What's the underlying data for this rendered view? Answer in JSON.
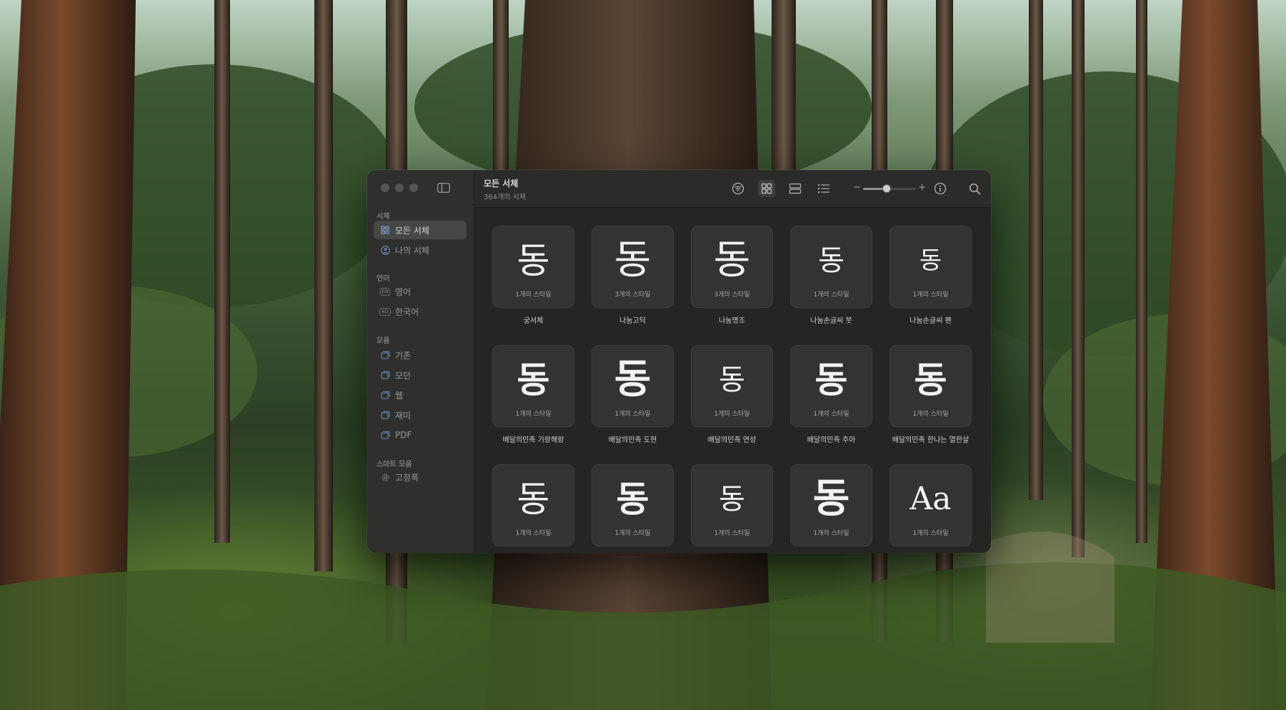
{
  "window": {
    "title": "모든 서체",
    "subtitle": "364개의 서체"
  },
  "sidebar": {
    "sections": {
      "fonts": "서체",
      "language": "언어",
      "collections": "모음",
      "smart": "스마트 모음"
    },
    "items": [
      {
        "label": "모든 서체",
        "icon": "grid-icon",
        "active": true
      },
      {
        "label": "나의 서체",
        "icon": "person-icon"
      },
      {
        "label": "영어",
        "icon": "language-badge-icon",
        "badge": "EN"
      },
      {
        "label": "한국어",
        "icon": "language-badge-icon",
        "badge": "KO"
      },
      {
        "label": "기존",
        "icon": "collection-icon"
      },
      {
        "label": "모던",
        "icon": "collection-icon"
      },
      {
        "label": "웹",
        "icon": "collection-icon"
      },
      {
        "label": "재미",
        "icon": "collection-icon"
      },
      {
        "label": "PDF",
        "icon": "collection-icon"
      },
      {
        "label": "고정폭",
        "icon": "gear-icon"
      }
    ]
  },
  "toolbar": {
    "buttons": [
      "filter-icon",
      "grid-view-icon",
      "strip-view-icon",
      "list-view-icon",
      "info-icon",
      "search-icon"
    ],
    "zoom_minus": "−",
    "zoom_plus": "+",
    "zoom_level": 0.45
  },
  "fonts": [
    {
      "glyph": "동",
      "styles": "1개의 스타일",
      "name": "궁서체"
    },
    {
      "glyph": "동",
      "styles": "3개의 스타일",
      "name": "나눔고딕"
    },
    {
      "glyph": "동",
      "styles": "3개의 스타일",
      "name": "나눔명조"
    },
    {
      "glyph": "동",
      "styles": "1개의 스타일",
      "name": "나눔손글씨 붓"
    },
    {
      "glyph": "동",
      "styles": "1개의 스타일",
      "name": "나눔손글씨 펜"
    },
    {
      "glyph": "동",
      "styles": "1개의 스타일",
      "name": "배달의민족 기랑해랑"
    },
    {
      "glyph": "동",
      "styles": "1개의 스타일",
      "name": "배달의민족 도현"
    },
    {
      "glyph": "동",
      "styles": "1개의 스타일",
      "name": "배달의민족 연성"
    },
    {
      "glyph": "동",
      "styles": "1개의 스타일",
      "name": "배달의민족 주아"
    },
    {
      "glyph": "동",
      "styles": "1개의 스타일",
      "name": "배달의민족 한나는 열한살"
    },
    {
      "glyph": "동",
      "styles": "1개의 스타일",
      "name": ""
    },
    {
      "glyph": "동",
      "styles": "1개의 스타일",
      "name": ""
    },
    {
      "glyph": "동",
      "styles": "1개의 스타일",
      "name": ""
    },
    {
      "glyph": "동",
      "styles": "1개의 스타일",
      "name": ""
    },
    {
      "glyph": "Aa",
      "styles": "1개의 스타일",
      "name": ""
    }
  ],
  "colors": {
    "window_bg": "#252523",
    "sidebar_bg": "#2f2f2d",
    "sidebar_active": "#474745",
    "tile_bg": "#333331",
    "text_primary": "#d9d9d6",
    "text_secondary": "#8a8a87"
  }
}
